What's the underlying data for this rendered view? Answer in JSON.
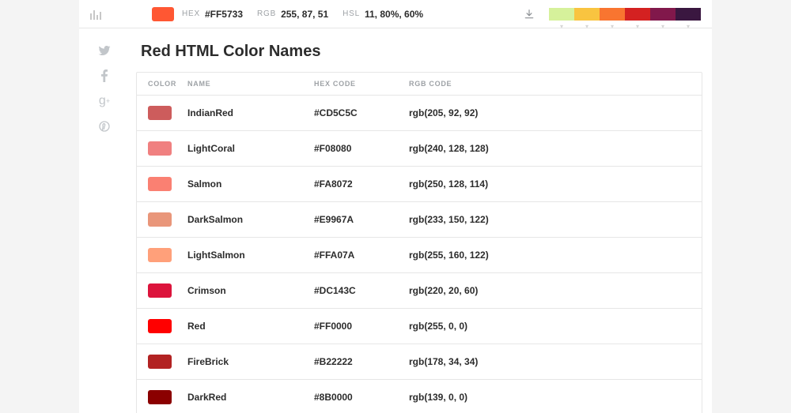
{
  "top": {
    "main_color": "#FF5733",
    "hex_label": "HEX",
    "hex_value": "#FF5733",
    "rgb_label": "RGB",
    "rgb_value": "255, 87, 51",
    "hsl_label": "HSL",
    "hsl_value": "11, 80%, 60%"
  },
  "palette": [
    {
      "color": "#d6f19b"
    },
    {
      "color": "#f9c440"
    },
    {
      "color": "#f97530"
    },
    {
      "color": "#d42121"
    },
    {
      "color": "#81184b"
    },
    {
      "color": "#3a1740"
    }
  ],
  "title": "Red HTML Color Names",
  "columns": {
    "color": "COLOR",
    "name": "NAME",
    "hex": "HEX CODE",
    "rgb": "RGB CODE"
  },
  "rows": [
    {
      "swatch": "#CD5C5C",
      "name": "IndianRed",
      "hex": "#CD5C5C",
      "rgb": "rgb(205, 92, 92)"
    },
    {
      "swatch": "#F08080",
      "name": "LightCoral",
      "hex": "#F08080",
      "rgb": "rgb(240, 128, 128)"
    },
    {
      "swatch": "#FA8072",
      "name": "Salmon",
      "hex": "#FA8072",
      "rgb": "rgb(250, 128, 114)"
    },
    {
      "swatch": "#E9967A",
      "name": "DarkSalmon",
      "hex": "#E9967A",
      "rgb": "rgb(233, 150, 122)"
    },
    {
      "swatch": "#FFA07A",
      "name": "LightSalmon",
      "hex": "#FFA07A",
      "rgb": "rgb(255, 160, 122)"
    },
    {
      "swatch": "#DC143C",
      "name": "Crimson",
      "hex": "#DC143C",
      "rgb": "rgb(220, 20, 60)"
    },
    {
      "swatch": "#FF0000",
      "name": "Red",
      "hex": "#FF0000",
      "rgb": "rgb(255, 0, 0)"
    },
    {
      "swatch": "#B22222",
      "name": "FireBrick",
      "hex": "#B22222",
      "rgb": "rgb(178, 34, 34)"
    },
    {
      "swatch": "#8B0000",
      "name": "DarkRed",
      "hex": "#8B0000",
      "rgb": "rgb(139, 0, 0)"
    }
  ]
}
